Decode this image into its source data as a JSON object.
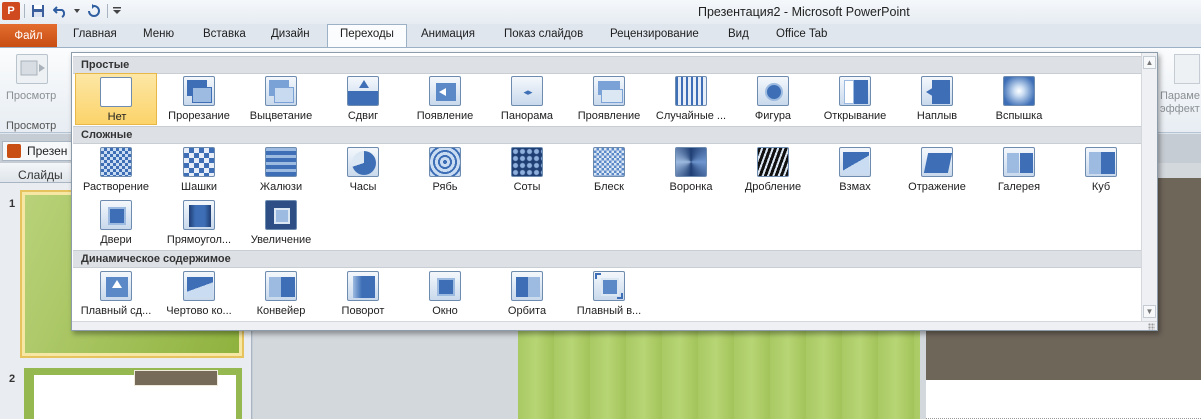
{
  "titlebar": {
    "app_icon_letter": "P",
    "title": "Презентация2 - Microsoft PowerPoint"
  },
  "tabs": {
    "file": "Файл",
    "items": [
      "Главная",
      "Меню",
      "Вставка",
      "Дизайн",
      "Переходы",
      "Анимация",
      "Показ слайдов",
      "Рецензирование",
      "Вид",
      "Office Tab"
    ],
    "active": "Переходы"
  },
  "ribbon": {
    "preview_label": "Просмотр",
    "preview_group_label": "Просмотр",
    "right_stub_label_1": "Параме",
    "right_stub_label_2": "эффект"
  },
  "document_tab": "Презен",
  "slides_pane": {
    "label": "Слайды",
    "slide_numbers": [
      "1",
      "2"
    ]
  },
  "gallery": {
    "sections": {
      "simple": "Простые",
      "complex": "Сложные",
      "dynamic": "Динамическое содержимое"
    },
    "simple_items": [
      "Нет",
      "Прорезание",
      "Выцветание",
      "Сдвиг",
      "Появление",
      "Панорама",
      "Проявление",
      "Случайные ...",
      "Фигура",
      "Открывание",
      "Наплыв",
      "Вспышка"
    ],
    "complex_items": [
      "Растворение",
      "Шашки",
      "Жалюзи",
      "Часы",
      "Рябь",
      "Соты",
      "Блеск",
      "Воронка",
      "Дробление",
      "Взмах",
      "Отражение",
      "Галерея",
      "Куб",
      "Двери",
      "Прямоугол...",
      "Увеличение"
    ],
    "dynamic_items": [
      "Плавный сд...",
      "Чертово ко...",
      "Конвейер",
      "Поворот",
      "Окно",
      "Орбита",
      "Плавный в..."
    ],
    "selected": "Нет"
  },
  "colors": {
    "file_tab": "#d65a1c",
    "selection": "#fbd36a",
    "slide_green": "#a8c964",
    "slide_brown": "#6f665a"
  }
}
